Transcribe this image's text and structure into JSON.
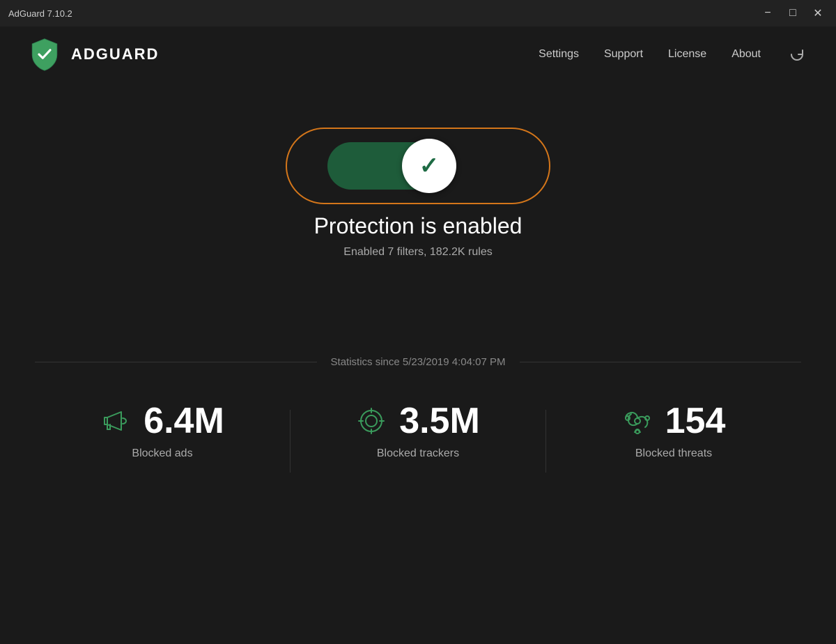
{
  "titlebar": {
    "title": "AdGuard 7.10.2",
    "minimize_label": "−",
    "maximize_label": "□",
    "close_label": "✕"
  },
  "header": {
    "logo_text": "ADGUARD",
    "nav": {
      "settings": "Settings",
      "support": "Support",
      "license": "License",
      "about": "About"
    }
  },
  "main": {
    "protection_status": "Protection is enabled",
    "protection_detail": "Enabled 7 filters, 182.2K rules",
    "stats_since": "Statistics since 5/23/2019 4:04:07 PM",
    "stats": [
      {
        "id": "ads",
        "number": "6.4M",
        "label": "Blocked ads"
      },
      {
        "id": "trackers",
        "number": "3.5M",
        "label": "Blocked trackers"
      },
      {
        "id": "threats",
        "number": "154",
        "label": "Blocked threats"
      }
    ]
  }
}
